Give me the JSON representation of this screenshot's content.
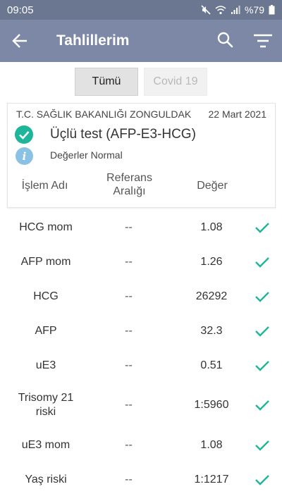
{
  "status_bar": {
    "time": "09:05",
    "battery": "%79"
  },
  "app_bar": {
    "title": "Tahlillerim"
  },
  "tabs": [
    {
      "label": "Tümü",
      "selected": true
    },
    {
      "label": "Covid 19",
      "selected": false
    }
  ],
  "card": {
    "institution": "T.C. SAĞLIK BAKANLIĞI ZONGULDAK",
    "date": "22 Mart 2021",
    "test_name": "Üçlü test (AFP-E3-HCG)",
    "status": "Değerler Normal",
    "headers": {
      "name": "İşlem Adı",
      "reference": "Referans Aralığı",
      "value": "Değer"
    }
  },
  "rows": [
    {
      "name": "HCG mom",
      "reference": "--",
      "value": "1.08"
    },
    {
      "name": "AFP mom",
      "reference": "--",
      "value": "1.26"
    },
    {
      "name": "HCG",
      "reference": "--",
      "value": "26292"
    },
    {
      "name": "AFP",
      "reference": "--",
      "value": "32.3"
    },
    {
      "name": "uE3",
      "reference": "--",
      "value": "0.51"
    },
    {
      "name": "Trisomy 21 riski",
      "reference": "--",
      "value": "1:5960"
    },
    {
      "name": "uE3 mom",
      "reference": "--",
      "value": "1.08"
    },
    {
      "name": "Yaş riski",
      "reference": "--",
      "value": "1:1217"
    }
  ],
  "colors": {
    "app_bar": "#7d88a6",
    "status_bar": "#6b7690",
    "accent": "#1fb59a",
    "info": "#8cc1e6"
  },
  "icons": [
    "back-arrow-icon",
    "search-icon",
    "filter-icon",
    "check-circle-icon",
    "info-icon",
    "check-icon",
    "mute-icon",
    "wifi-icon",
    "signal-icon",
    "battery-icon"
  ]
}
